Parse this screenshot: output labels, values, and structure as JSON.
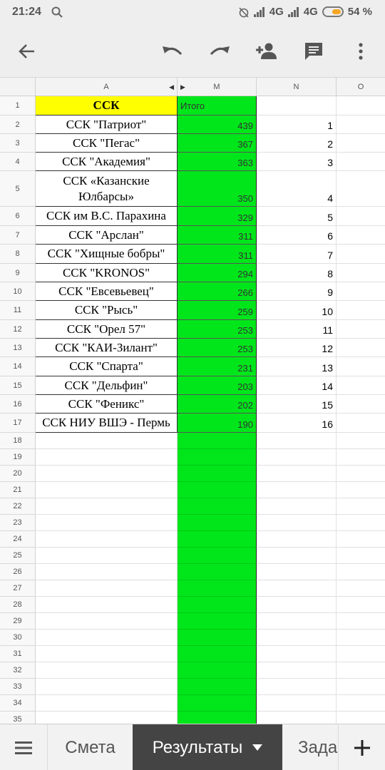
{
  "status_bar": {
    "time": "21:24",
    "network1": "4G",
    "network2": "4G",
    "battery": "54 %"
  },
  "toolbar": {
    "back_icon": "arrow-left-icon",
    "undo_icon": "undo-icon",
    "redo_icon": "redo-icon",
    "add_person_icon": "add-person-icon",
    "comment_icon": "comment-icon",
    "more_icon": "more-vert-icon"
  },
  "columns": [
    "A",
    "M",
    "N",
    "O"
  ],
  "header_row": {
    "number": "1",
    "a": "ССК",
    "m": "Итого"
  },
  "rows": [
    {
      "number": "2",
      "team": "ССК \"Патриот\"",
      "total": "439",
      "rank": "1"
    },
    {
      "number": "3",
      "team": "ССК \"Пегас\"",
      "total": "367",
      "rank": "2"
    },
    {
      "number": "4",
      "team": "ССК \"Академия\"",
      "total": "363",
      "rank": "3"
    },
    {
      "number": "5",
      "team": "ССК «Казанские Юлбарсы»",
      "total": "350",
      "rank": "4"
    },
    {
      "number": "6",
      "team": "ССК им В.С. Парахина",
      "total": "329",
      "rank": "5"
    },
    {
      "number": "7",
      "team": "ССК \"Арслан\"",
      "total": "311",
      "rank": "6"
    },
    {
      "number": "8",
      "team": "ССК \"Хищные бобры\"",
      "total": "311",
      "rank": "7"
    },
    {
      "number": "9",
      "team": "ССК \"KRONOS\"",
      "total": "294",
      "rank": "8"
    },
    {
      "number": "10",
      "team": "ССК \"Евсевьевец\"",
      "total": "266",
      "rank": "9"
    },
    {
      "number": "11",
      "team": "ССК \"Рысь\"",
      "total": "259",
      "rank": "10"
    },
    {
      "number": "12",
      "team": "ССК \"Орел 57\"",
      "total": "253",
      "rank": "11"
    },
    {
      "number": "13",
      "team": "ССК \"КАИ-Зилант\"",
      "total": "253",
      "rank": "12"
    },
    {
      "number": "14",
      "team": "ССК \"Спарта\"",
      "total": "231",
      "rank": "13"
    },
    {
      "number": "15",
      "team": "ССК \"Дельфин\"",
      "total": "203",
      "rank": "14"
    },
    {
      "number": "16",
      "team": "ССК \"Феникс\"",
      "total": "202",
      "rank": "15"
    },
    {
      "number": "17",
      "team": "ССК НИУ ВШЭ - Пермь",
      "total": "190",
      "rank": "16"
    }
  ],
  "empty_rows": [
    "18",
    "19",
    "20",
    "21",
    "22",
    "23",
    "24",
    "25",
    "26",
    "27",
    "28",
    "29",
    "30",
    "31",
    "32",
    "33",
    "34",
    "35"
  ],
  "sheet_tabs": {
    "menu_icon": "hamburger-menu-icon",
    "tab1": "Смета",
    "tab2": "Результаты",
    "tab3": "Зада",
    "add_icon": "plus-icon"
  },
  "colors": {
    "accent_green": "#00e61a",
    "header_yellow": "#ffff00",
    "active_tab": "#444444",
    "battery_orange": "#f5a623"
  }
}
